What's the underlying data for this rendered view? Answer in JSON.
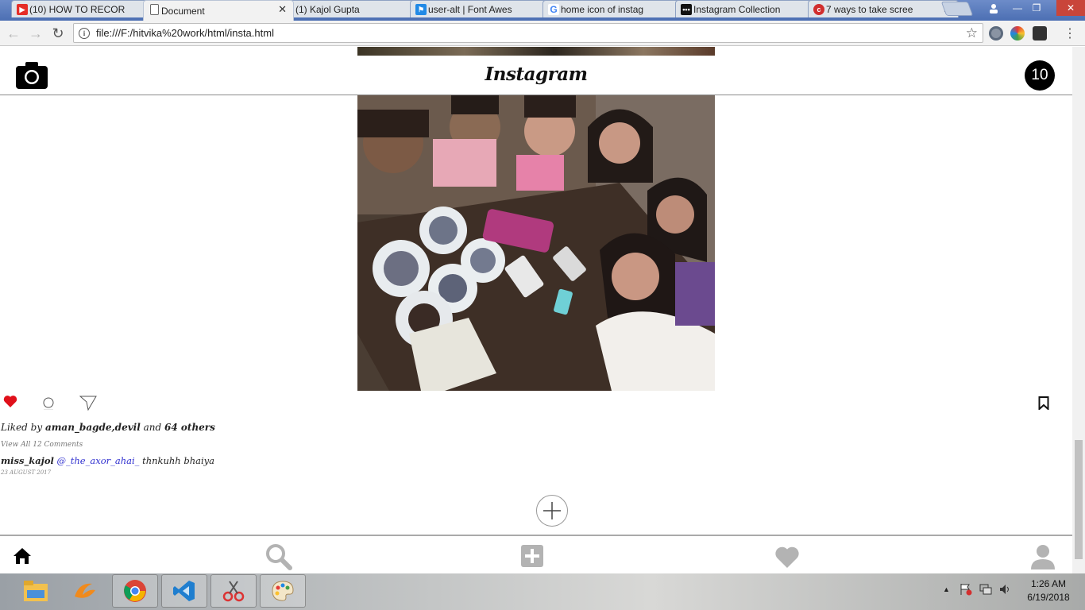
{
  "browser": {
    "tabs": [
      {
        "title": "(10) HOW TO RECOR",
        "favicon": "youtube-icon"
      },
      {
        "title": "Document",
        "favicon": "page-icon"
      },
      {
        "title": "(1) Kajol Gupta",
        "favicon": "facebook-icon"
      },
      {
        "title": "user-alt | Font Awes",
        "favicon": "fontawesome-icon"
      },
      {
        "title": "home icon of instag",
        "favicon": "google-icon"
      },
      {
        "title": "Instagram Collection",
        "favicon": "dots-icon"
      },
      {
        "title": "7 ways to take scree",
        "favicon": "red-c-icon"
      }
    ],
    "active_tab": 1,
    "url": "file:///F:/hitvika%20work/html/insta.html"
  },
  "page": {
    "brand": "Instagram",
    "notification_count": "10",
    "likes": {
      "prefix": "Liked by ",
      "users": "aman_bagde,devil",
      "and": " and ",
      "others": "64 others"
    },
    "view_comments": "View All 12 Comments",
    "caption": {
      "user": "miss_kajol",
      "mention": "@_the_axor_ahai_",
      "text": " thnkuhh bhaiya"
    },
    "date": "23 AUGUST 2017",
    "liked": true,
    "colors": {
      "like": "#e0101a",
      "mention": "#2f2fcf"
    }
  },
  "taskbar": {
    "apps": [
      "file-explorer-icon",
      "app-swirl-icon",
      "chrome-icon",
      "vscode-icon",
      "snipping-tool-icon",
      "paint-icon"
    ],
    "clock_time": "1:26 AM",
    "clock_date": "6/19/2018"
  }
}
